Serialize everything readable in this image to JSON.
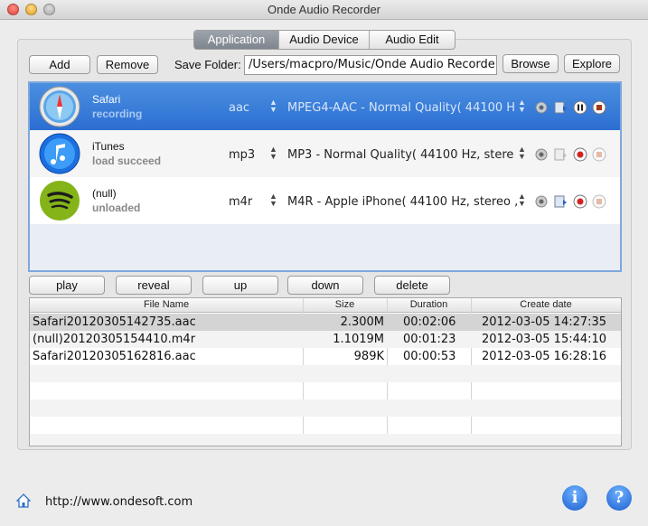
{
  "window": {
    "title": "Onde Audio Recorder"
  },
  "tabs": [
    {
      "label": "Application",
      "active": true
    },
    {
      "label": "Audio Device",
      "active": false
    },
    {
      "label": "Audio Edit",
      "active": false
    }
  ],
  "toolbar": {
    "add_label": "Add",
    "remove_label": "Remove",
    "save_folder_label": "Save Folder:",
    "save_folder_value": "/Users/macpro/Music/Onde Audio Recorde",
    "browse_label": "Browse",
    "explore_label": "Explore"
  },
  "apps": [
    {
      "name": "Safari",
      "status": "recording",
      "format": "aac",
      "quality": "MPEG4-AAC - Normal Quality( 44100 H",
      "selected": true,
      "icon": "safari-icon"
    },
    {
      "name": "iTunes",
      "status": "load succeed",
      "format": "mp3",
      "quality": "MP3 - Normal Quality( 44100 Hz, stere",
      "selected": false,
      "icon": "itunes-icon"
    },
    {
      "name": "(null)",
      "status": "unloaded",
      "format": "m4r",
      "quality": "M4R - Apple iPhone( 44100 Hz, stereo ,",
      "selected": false,
      "icon": "spotify-icon"
    }
  ],
  "file_actions": {
    "play_label": "play",
    "reveal_label": "reveal",
    "up_label": "up",
    "down_label": "down",
    "delete_label": "delete"
  },
  "files": {
    "columns": [
      "File Name",
      "Size",
      "Duration",
      "Create date"
    ],
    "rows": [
      [
        "Safari20120305142735.aac",
        "2.300M",
        "00:02:06",
        "2012-03-05 14:27:35"
      ],
      [
        "(null)20120305154410.m4r",
        "1.1019M",
        "00:01:23",
        "2012-03-05 15:44:10"
      ],
      [
        "Safari20120305162816.aac",
        "989K",
        "00:00:53",
        "2012-03-05 16:28:16"
      ]
    ]
  },
  "footer": {
    "url": "http://www.ondesoft.com"
  },
  "colors": {
    "selection": "#2c6ed2",
    "accent": "#1d5fd0"
  }
}
